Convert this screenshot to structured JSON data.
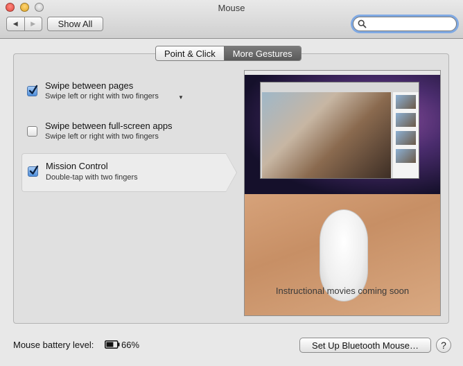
{
  "window": {
    "title": "Mouse"
  },
  "toolbar": {
    "back_icon": "back-arrow-icon",
    "forward_icon": "forward-arrow-icon",
    "show_all_label": "Show All",
    "search_value": ""
  },
  "tabs": [
    {
      "label": "Point & Click",
      "selected": false
    },
    {
      "label": "More Gestures",
      "selected": true
    }
  ],
  "gestures": [
    {
      "title": "Swipe between pages",
      "subtitle": "Swipe left or right with two fingers",
      "checked": true,
      "has_popup": true,
      "selected": false
    },
    {
      "title": "Swipe between full-screen apps",
      "subtitle": "Swipe left or right with two fingers",
      "checked": false,
      "has_popup": false,
      "selected": false
    },
    {
      "title": "Mission Control",
      "subtitle": "Double-tap with two fingers",
      "checked": true,
      "has_popup": false,
      "selected": true
    }
  ],
  "preview": {
    "note": "Instructional movies coming soon"
  },
  "footer": {
    "battery_label": "Mouse battery level:",
    "battery_percent": "66%",
    "battery_level": 0.66,
    "bluetooth_button": "Set Up Bluetooth Mouse…",
    "help_label": "?"
  },
  "colors": {
    "accent": "#4f8fdb",
    "active_tab": "#5a5a5a",
    "search_focus": "#7fa9e3"
  }
}
